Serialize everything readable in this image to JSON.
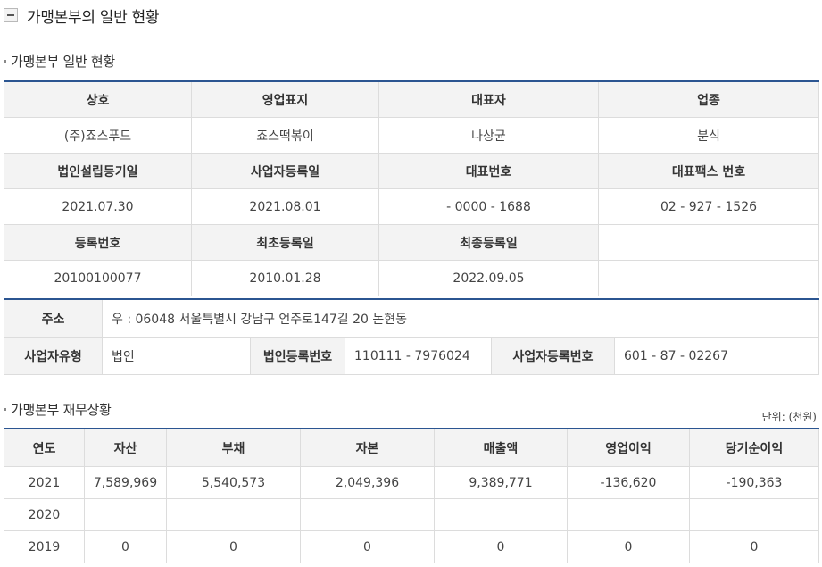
{
  "section": {
    "title": "가맹본부의 일반 현황"
  },
  "general": {
    "title": "가맹본부 일반 현황",
    "rows": [
      {
        "type": "header",
        "cells": [
          "상호",
          "영업표지",
          "대표자",
          "업종"
        ]
      },
      {
        "type": "value",
        "cells": [
          "(주)죠스푸드",
          "죠스떡볶이",
          "나상균",
          "분식"
        ]
      },
      {
        "type": "header",
        "cells": [
          "법인설립등기일",
          "사업자등록일",
          "대표번호",
          "대표팩스 번호"
        ]
      },
      {
        "type": "value",
        "cells": [
          "2021.07.30",
          "2021.08.01",
          "- 0000 - 1688",
          "02 - 927 - 1526"
        ]
      },
      {
        "type": "header",
        "cells": [
          "등록번호",
          "최초등록일",
          "최종등록일",
          ""
        ]
      },
      {
        "type": "value",
        "cells": [
          "20100100077",
          "2010.01.28",
          "2022.09.05",
          ""
        ]
      }
    ]
  },
  "business": {
    "address_label": "주소",
    "address_value": "우 : 06048 서울특별시 강남구 언주로147길 20 논현동",
    "type_label": "사업자유형",
    "type_value": "법인",
    "corp_reg_label": "법인등록번호",
    "corp_reg_value": "110111 - 7976024",
    "biz_reg_label": "사업자등록번호",
    "biz_reg_value": "601 - 87 - 02267"
  },
  "finance": {
    "title": "가맹본부 재무상황",
    "unit": "단위: (천원)",
    "headers": [
      "연도",
      "자산",
      "부채",
      "자본",
      "매출액",
      "영업이익",
      "당기순이익"
    ],
    "rows": [
      [
        "2021",
        "7,589,969",
        "5,540,573",
        "2,049,396",
        "9,389,771",
        "-136,620",
        "-190,363"
      ],
      [
        "2020",
        "",
        "",
        "",
        "",
        "",
        ""
      ],
      [
        "2019",
        "0",
        "0",
        "0",
        "0",
        "0",
        "0"
      ]
    ]
  }
}
